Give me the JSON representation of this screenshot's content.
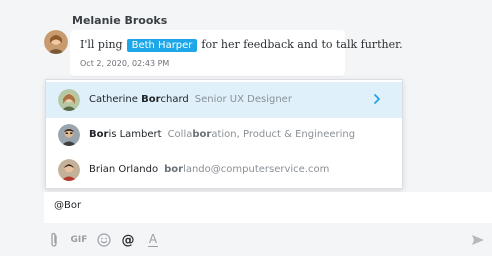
{
  "message": {
    "sender": "Melanie Brooks",
    "text_before": "I'll ping",
    "mention": "Beth Harper",
    "text_after": "for her feedback and to talk further.",
    "timestamp": "Oct 2, 2020, 02:43 PM"
  },
  "suggestions": [
    {
      "name_before": "Catherine ",
      "name_match": "Bor",
      "name_after": "chard",
      "sub_before": "Senior UX Designer",
      "sub_match": "",
      "sub_after": "",
      "selected": true
    },
    {
      "name_before": "",
      "name_match": "Bor",
      "name_after": "is Lambert",
      "sub_before": "Colla",
      "sub_match": "bor",
      "sub_after": "ation, Product & Engineering",
      "selected": false
    },
    {
      "name_before": "Brian Orlando",
      "name_match": "",
      "name_after": "",
      "sub_before": "",
      "sub_match": "bor",
      "sub_after": "lando@computerservice.com",
      "selected": false
    }
  ],
  "compose": {
    "value": "@Bor"
  },
  "toolbar": {
    "gif_label": "GIF",
    "at_label": "@",
    "format_label": "A"
  },
  "colors": {
    "accent": "#1ea7e8",
    "selected_bg": "#dff0fb"
  }
}
